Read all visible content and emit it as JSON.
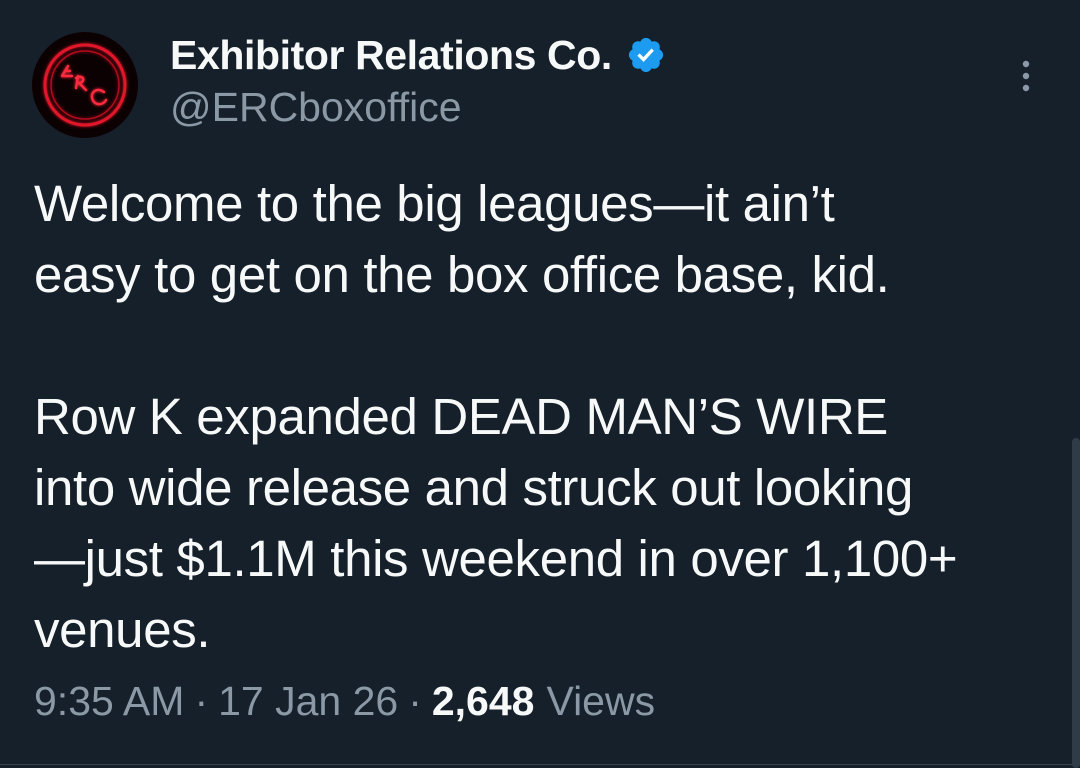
{
  "author": {
    "display_name": "Exhibitor Relations Co.",
    "handle": "@ERCboxoffice",
    "verified": true,
    "verified_color": "#1d9bf0",
    "avatar_logo_text": "ERC",
    "avatar_color": "#e0142a"
  },
  "tweet": {
    "lines": [
      "Welcome to the big leagues—it ain’t",
      "easy to get on the box office base, kid.",
      "",
      "Row K expanded DEAD MAN’S WIRE",
      "into wide release and struck out looking",
      "—just $1.1M this weekend in over 1,100+",
      "venues."
    ]
  },
  "meta": {
    "time": "9:35 AM",
    "separator": "·",
    "date": "17 Jan 26",
    "views_count": "2,648",
    "views_label": "Views"
  },
  "icons": {
    "more": "more-vertical-icon",
    "verified": "verified-badge-icon"
  },
  "colors": {
    "background": "#15202b",
    "primary_text": "#f7f9f9",
    "secondary_text": "#8b98a5",
    "accent": "#1d9bf0"
  }
}
